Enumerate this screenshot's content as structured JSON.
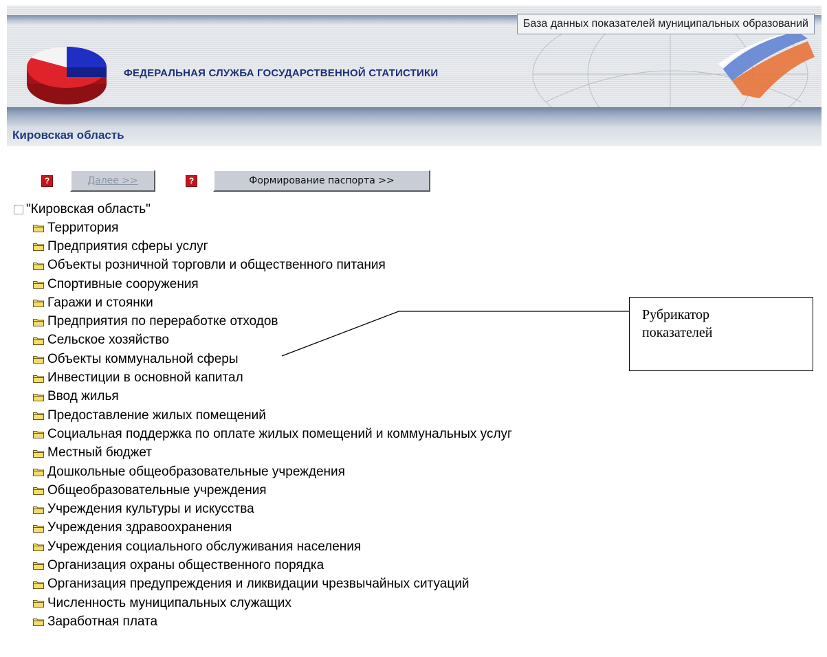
{
  "header": {
    "database_title": "База данных показателей муниципальных образований",
    "agency_name": "ФЕДЕРАЛЬНАЯ СЛУЖБА ГОСУДАРСТВЕННОЙ СТАТИСТИКИ",
    "colors": {
      "pie_red": "#d9141c",
      "pie_blue": "#1f2fc4",
      "pie_white": "#f4f4f4",
      "agency_text": "#1d2f7a"
    }
  },
  "region": {
    "title": "Кировская область"
  },
  "toolbar": {
    "help_glyph": "?",
    "next_label": "Далее >>",
    "passport_label": "Формирование паспорта >>"
  },
  "tree": {
    "root_label": "\"Кировская область\"",
    "items": [
      "Территория",
      "Предприятия сферы услуг",
      "Объекты розничной торговли и общественного питания",
      "Спортивные сооружения",
      "Гаражи и стоянки",
      "Предприятия по переработке отходов",
      "Сельское хозяйство",
      "Объекты коммунальной сферы",
      "Инвестиции в основной капитал",
      "Ввод жилья",
      "Предоставление жилых помещений",
      "Социальная поддержка по оплате жилых помещений и коммунальных услуг",
      "Местный бюджет",
      "Дошкольные общеобразовательные учреждения",
      "Общеобразовательные учреждения",
      "Учреждения культуры и искусства",
      "Учреждения здравоохранения",
      "Учреждения социального обслуживания населения",
      "Организация охраны общественного порядка",
      "Организация предупреждения и ликвидации чрезвычайных ситуаций",
      "Численность муниципальных служащих",
      "Заработная плата"
    ]
  },
  "callout": {
    "text": "Рубрикатор показателей"
  }
}
